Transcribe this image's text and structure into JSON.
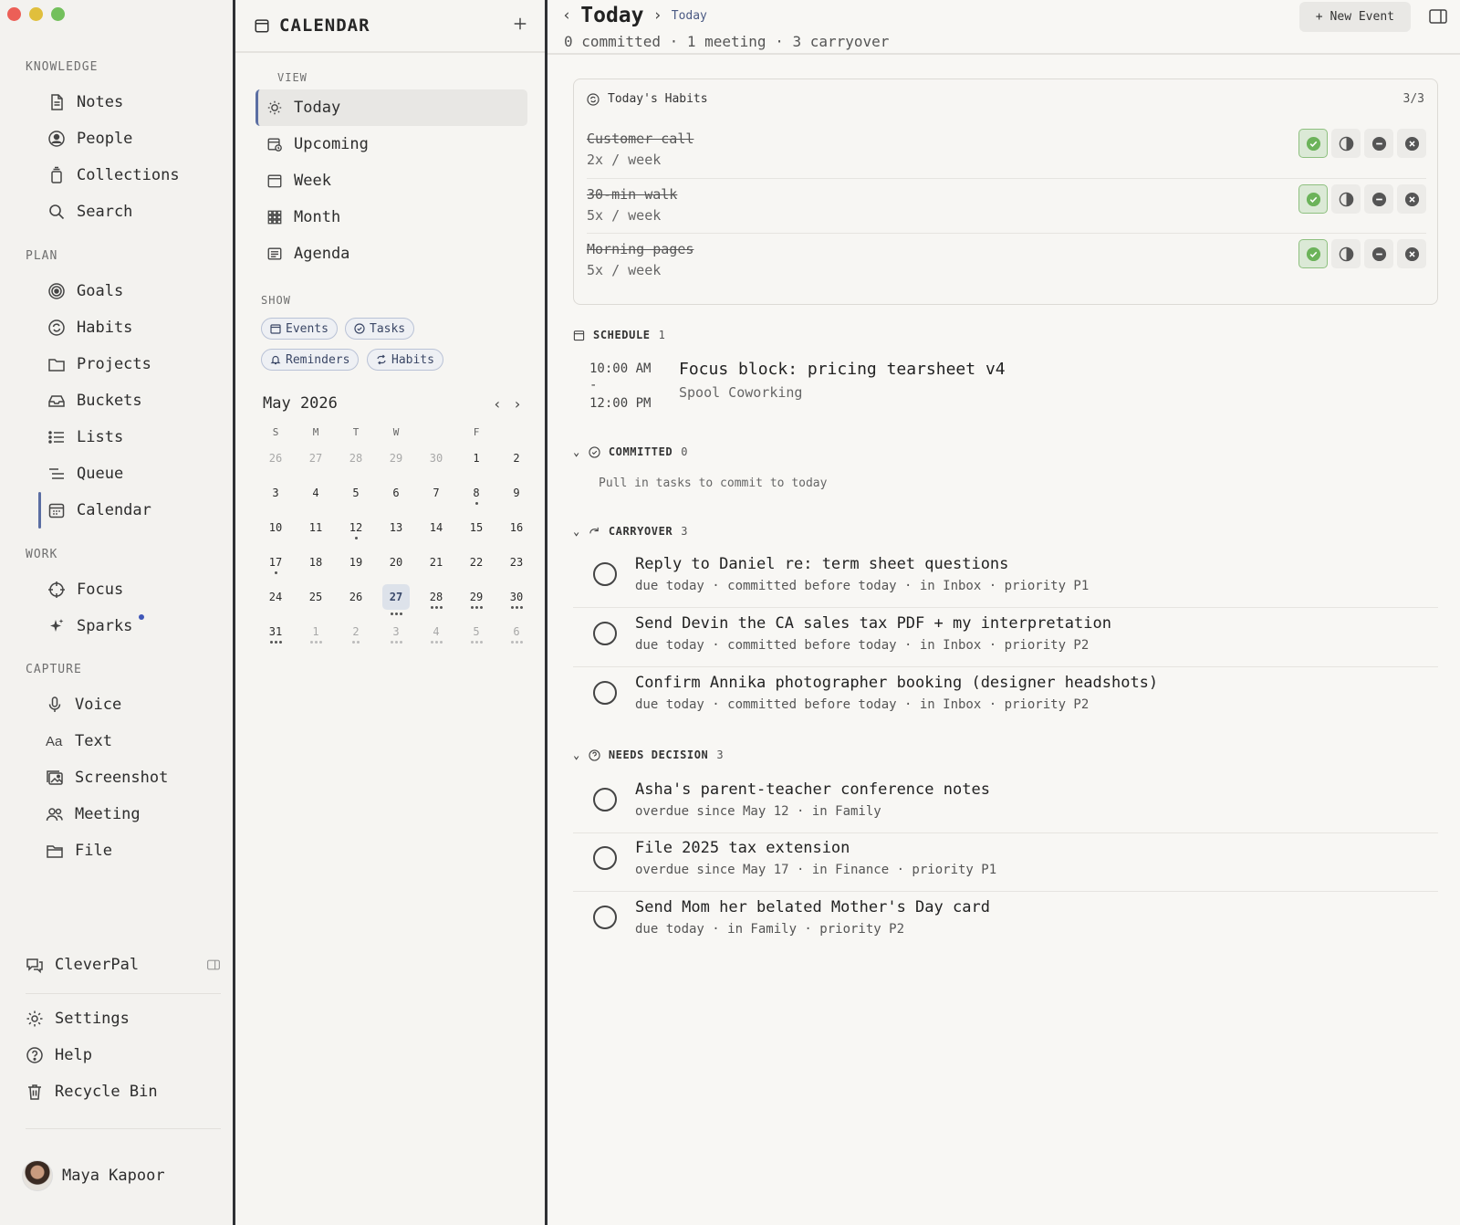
{
  "sidebar": {
    "sections": {
      "knowledge": "KNOWLEDGE",
      "plan": "PLAN",
      "work": "WORK",
      "capture": "CAPTURE"
    },
    "knowledge_items": [
      "Notes",
      "People",
      "Collections",
      "Search"
    ],
    "plan_items": [
      "Goals",
      "Habits",
      "Projects",
      "Buckets",
      "Lists",
      "Queue",
      "Calendar"
    ],
    "work_items": [
      "Focus",
      "Sparks"
    ],
    "capture_items": [
      "Voice",
      "Text",
      "Screenshot",
      "Meeting",
      "File"
    ],
    "assistant": "CleverPal",
    "footer_items": [
      "Settings",
      "Help",
      "Recycle Bin"
    ],
    "user_name": "Maya Kapoor",
    "text_icon_glyph": "Aa"
  },
  "calendar": {
    "title": "CALENDAR",
    "view_label": "VIEW",
    "views": [
      "Today",
      "Upcoming",
      "Week",
      "Month",
      "Agenda"
    ],
    "show_label": "SHOW",
    "filters": [
      "Events",
      "Tasks",
      "Reminders",
      "Habits"
    ],
    "month_label": "May 2026",
    "weekdays": [
      "S",
      "M",
      "T",
      "W",
      "",
      "F",
      ""
    ],
    "weeks": [
      [
        "26",
        "27",
        "28",
        "29",
        "30",
        "1",
        "2"
      ],
      [
        "3",
        "4",
        "5",
        "6",
        "7",
        "8",
        "9"
      ],
      [
        "10",
        "11",
        "12",
        "13",
        "14",
        "15",
        "16"
      ],
      [
        "17",
        "18",
        "19",
        "20",
        "21",
        "22",
        "23"
      ],
      [
        "24",
        "25",
        "26",
        "27",
        "28",
        "29",
        "30"
      ],
      [
        "31",
        "1",
        "2",
        "3",
        "4",
        "5",
        "6"
      ]
    ],
    "selected_day": "27"
  },
  "main": {
    "title": "Today",
    "breadcrumb_sub": "Today",
    "summary": "0 committed · 1 meeting · 3 carryover",
    "new_event_label": "New Event",
    "habits": {
      "title": "Today's Habits",
      "count": "3/3",
      "items": [
        {
          "name": "Customer call",
          "freq": "2x / week"
        },
        {
          "name": "30-min walk",
          "freq": "5x / week"
        },
        {
          "name": "Morning pages",
          "freq": "5x / week"
        }
      ]
    },
    "schedule": {
      "label": "SCHEDULE",
      "count": "1",
      "event": {
        "start": "10:00 AM",
        "dash": "-",
        "end": "12:00 PM",
        "title": "Focus block: pricing tearsheet v4",
        "location": "Spool Coworking"
      }
    },
    "committed": {
      "label": "COMMITTED",
      "count": "0",
      "empty": "Pull in tasks to commit to today"
    },
    "carryover": {
      "label": "CARRYOVER",
      "count": "3",
      "items": [
        {
          "title": "Reply to Daniel re: term sheet questions",
          "meta": "due today · committed before today · in Inbox · priority P1"
        },
        {
          "title": "Send Devin the CA sales tax PDF + my interpretation",
          "meta": "due today · committed before today · in Inbox · priority P2"
        },
        {
          "title": "Confirm Annika photographer booking (designer headshots)",
          "meta": "due today · committed before today · in Inbox · priority P2"
        }
      ]
    },
    "needs_decision": {
      "label": "NEEDS DECISION",
      "count": "3",
      "items": [
        {
          "title": "Asha's parent-teacher conference notes",
          "meta": "overdue since May 12 · in Family"
        },
        {
          "title": "File 2025 tax extension",
          "meta": "overdue since May 17 · in Finance · priority P1"
        },
        {
          "title": "Send Mom her belated Mother's Day card",
          "meta": "due today · in Family · priority P2"
        }
      ]
    }
  },
  "colors": {
    "accent": "#5b6ea3",
    "habit_done": "#6cb35a",
    "sparks_dot": "#3f57b8"
  }
}
